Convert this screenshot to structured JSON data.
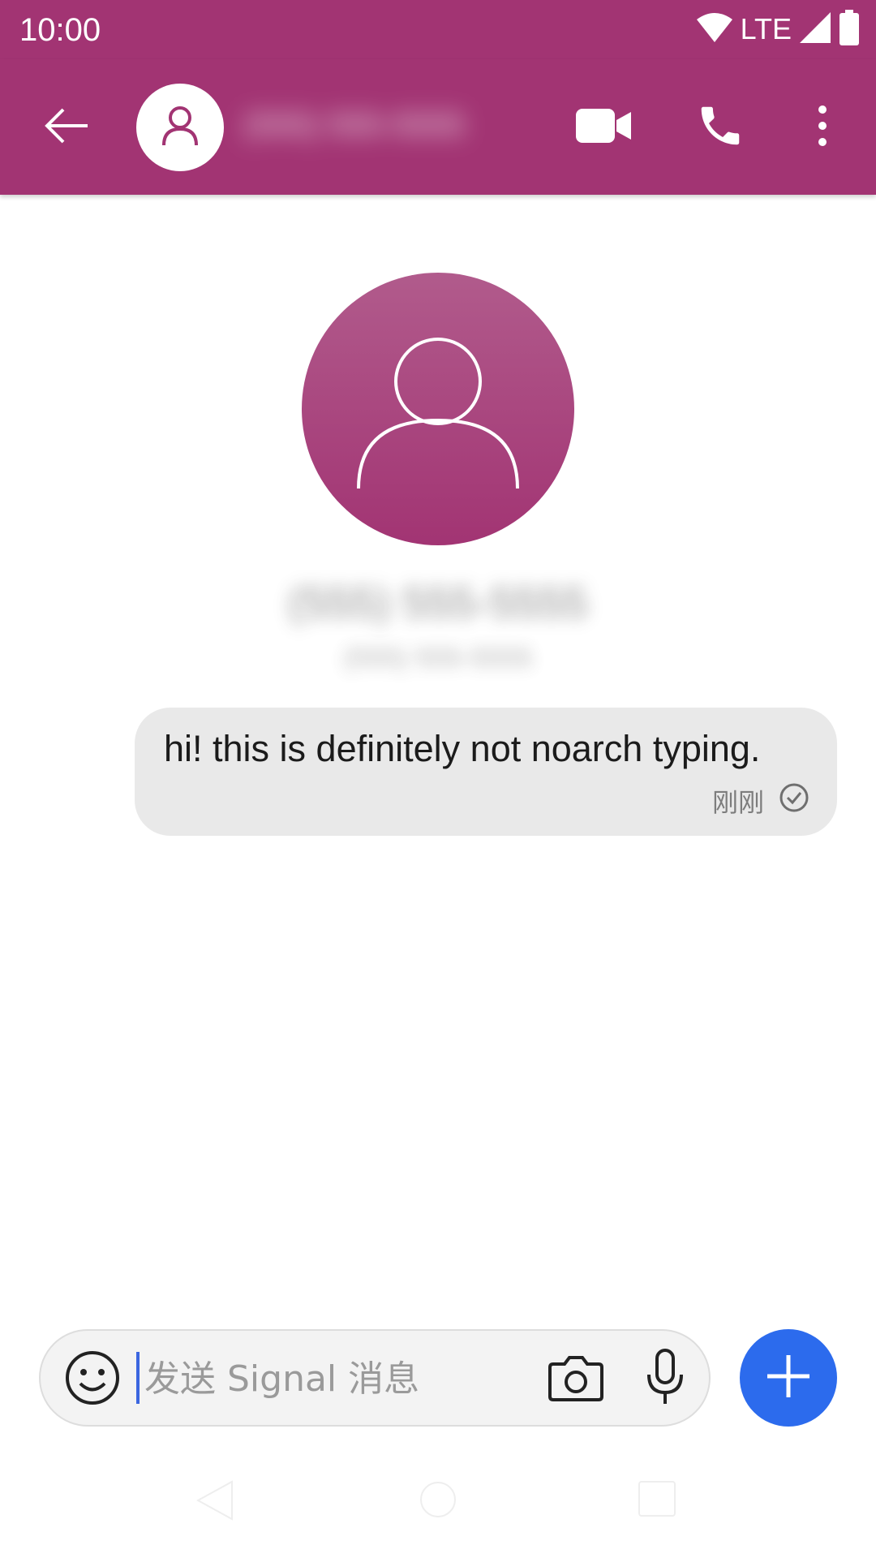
{
  "status_bar": {
    "time": "10:00",
    "network": "LTE",
    "icons": [
      "wifi-icon",
      "signal-icon",
      "battery-icon"
    ]
  },
  "toolbar": {
    "contact_name": "(555) 555-5555",
    "icons": [
      "back-arrow-icon",
      "person-icon",
      "video-camera-icon",
      "phone-icon",
      "more-vertical-icon"
    ]
  },
  "profile": {
    "name": "(555) 555-5555",
    "subtitle": "(555) 555-5555"
  },
  "messages": [
    {
      "text": "hi! this is definitely not noarch typing.",
      "time": "刚刚",
      "status": "sent"
    }
  ],
  "compose": {
    "placeholder": "发送 Signal 消息",
    "value": ""
  },
  "colors": {
    "accent": "#a23473",
    "fab": "#2c6bed",
    "bubble": "#e9e9e9"
  }
}
